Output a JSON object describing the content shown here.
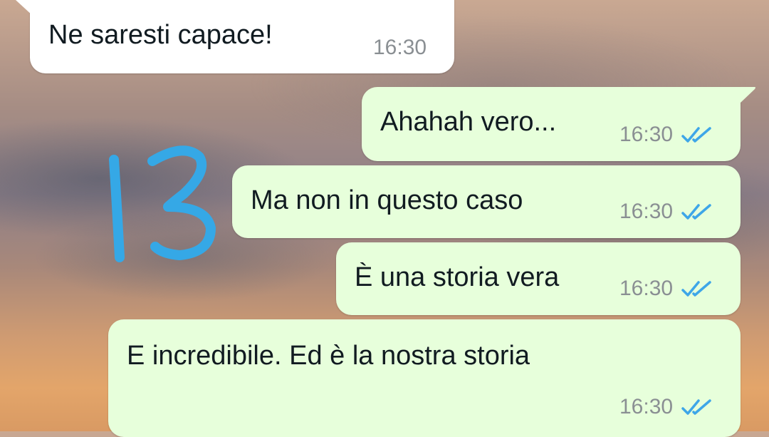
{
  "messages": [
    {
      "direction": "incoming",
      "text": "Ne saresti capace!",
      "time": "16:30"
    },
    {
      "direction": "outgoing",
      "text": "Ahahah vero...",
      "time": "16:30",
      "status": "read"
    },
    {
      "direction": "outgoing",
      "text": "Ma non in questo caso",
      "time": "16:30",
      "status": "read"
    },
    {
      "direction": "outgoing",
      "text": "È una storia vera",
      "time": "16:30",
      "status": "read"
    },
    {
      "direction": "outgoing",
      "text": "E incredibile. Ed è la nostra storia",
      "time": "16:30",
      "status": "read"
    }
  ],
  "annotation": {
    "text": "13",
    "color": "#35a8e6"
  },
  "colors": {
    "incoming_bubble": "#ffffff",
    "outgoing_bubble": "#e7ffdb",
    "read_ticks": "#3ea6e8",
    "time_text": "#8a8f93"
  },
  "icons": {
    "read_receipt": "double-check-icon"
  }
}
